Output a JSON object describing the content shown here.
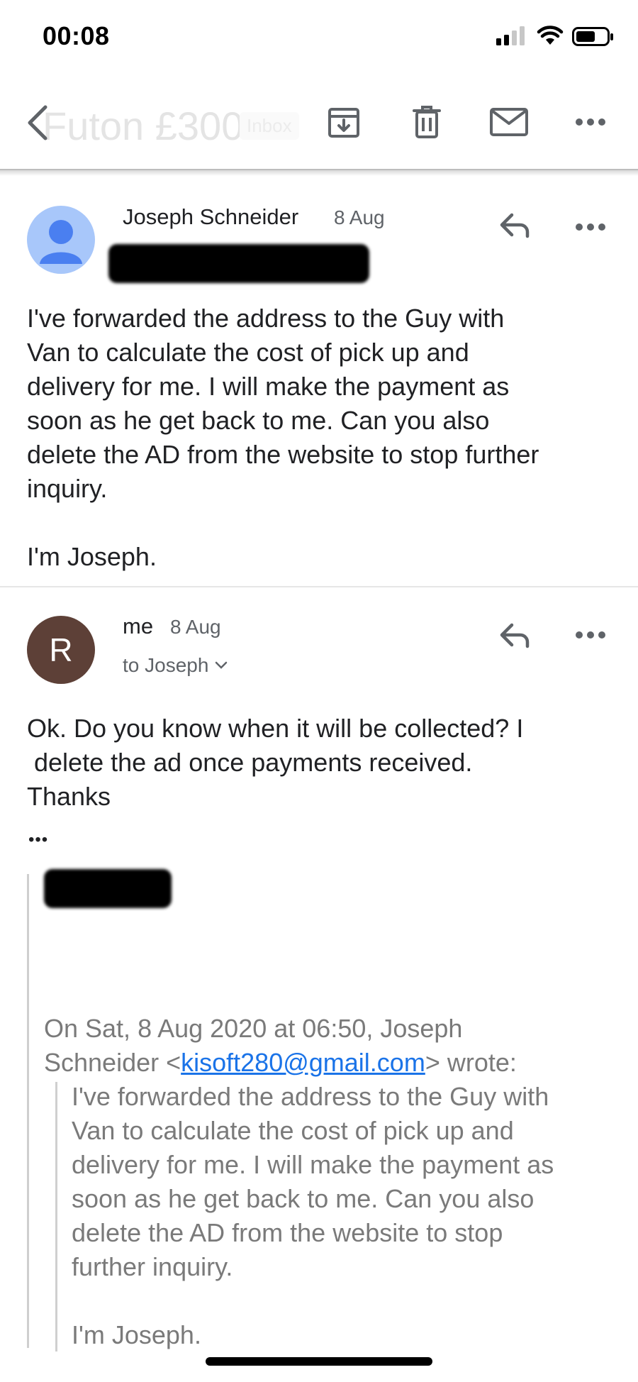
{
  "status_bar": {
    "time": "00:08"
  },
  "toolbar": {
    "subject": "Futon £300",
    "label": "Inbox",
    "actions": [
      "back-icon",
      "archive-icon",
      "delete-icon",
      "mark-unread-icon",
      "more-icon"
    ]
  },
  "messages": [
    {
      "sender": "Joseph Schneider",
      "date": "8 Aug",
      "avatar_color": "#a8c7fa",
      "body": "I've forwarded the address to the Guy with\nVan to calculate the cost of pick up and\ndelivery for me. I will make the payment as\nsoon as he get back to me. Can you also\ndelete the AD from the website to stop further\ninquiry.\n\nI'm Joseph."
    },
    {
      "sender": "me",
      "date": "8 Aug",
      "to": "to Joseph",
      "avatar_letter": "R",
      "avatar_color": "#5d4037",
      "body": "Ok. Do you know when it will be collected? I\n delete the ad once payments received.\nThanks",
      "collapsed_marker": "•••",
      "quote": {
        "header_prefix": "On Sat, 8 Aug 2020 at 06:50, Joseph\nSchneider <",
        "email": "kisoft280@gmail.com",
        "header_suffix": "> wrote:",
        "body": "I've forwarded the address to the Guy with\nVan to calculate the cost of pick up and\ndelivery for me. I will make the payment as\nsoon as he get back to me. Can you also\ndelete the AD from the website to stop\nfurther inquiry.\n\nI'm Joseph."
      }
    }
  ],
  "colors": {
    "accent": "#1a73e8",
    "icon": "#5f6368"
  }
}
